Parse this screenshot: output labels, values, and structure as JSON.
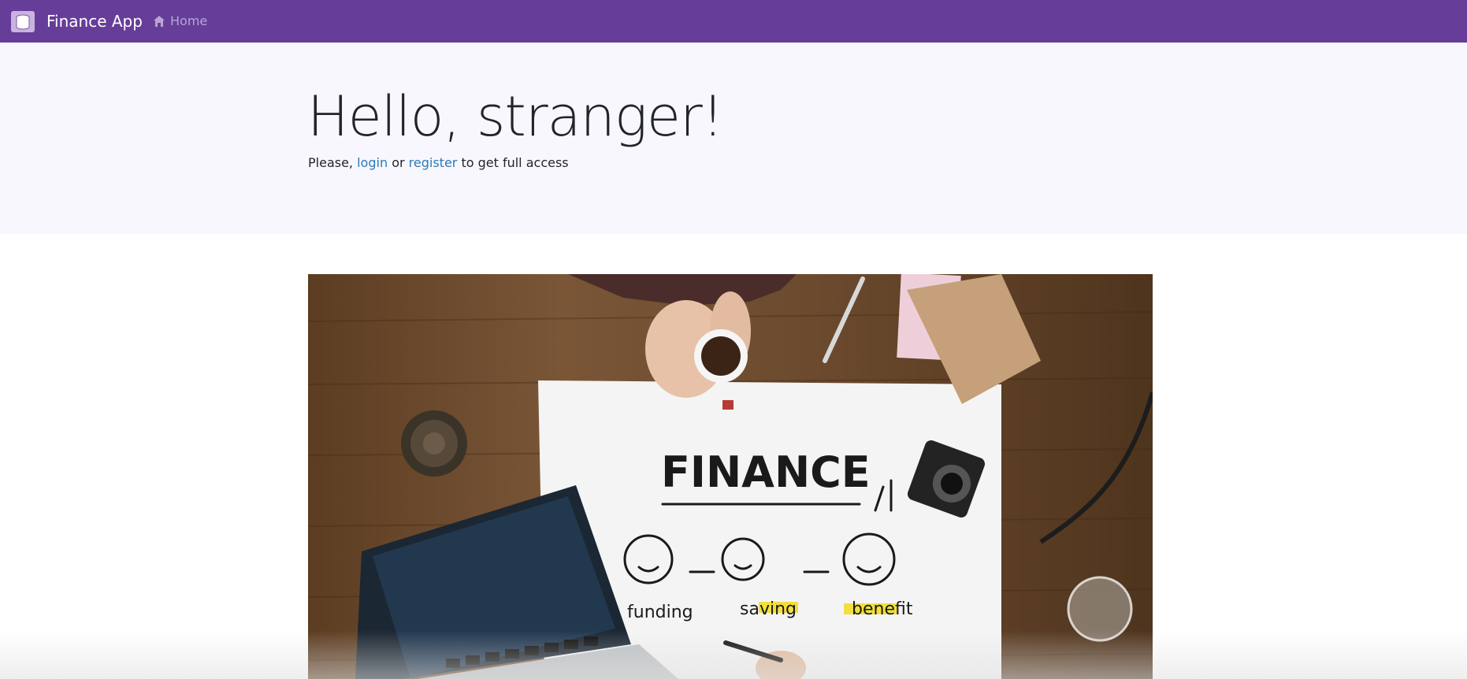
{
  "navbar": {
    "brand": "Finance App",
    "home_label": "Home",
    "background": "#663d99"
  },
  "hero": {
    "title": "Hello, stranger!",
    "lead_prefix": "Please,",
    "login_label": "login",
    "or_text": "or",
    "register_label": "register",
    "lead_suffix": "to get full access",
    "link_color": "#2b7bb9"
  },
  "image": {
    "headline": "FINANCE",
    "labels": [
      "funding",
      "saving",
      "benefit"
    ]
  }
}
